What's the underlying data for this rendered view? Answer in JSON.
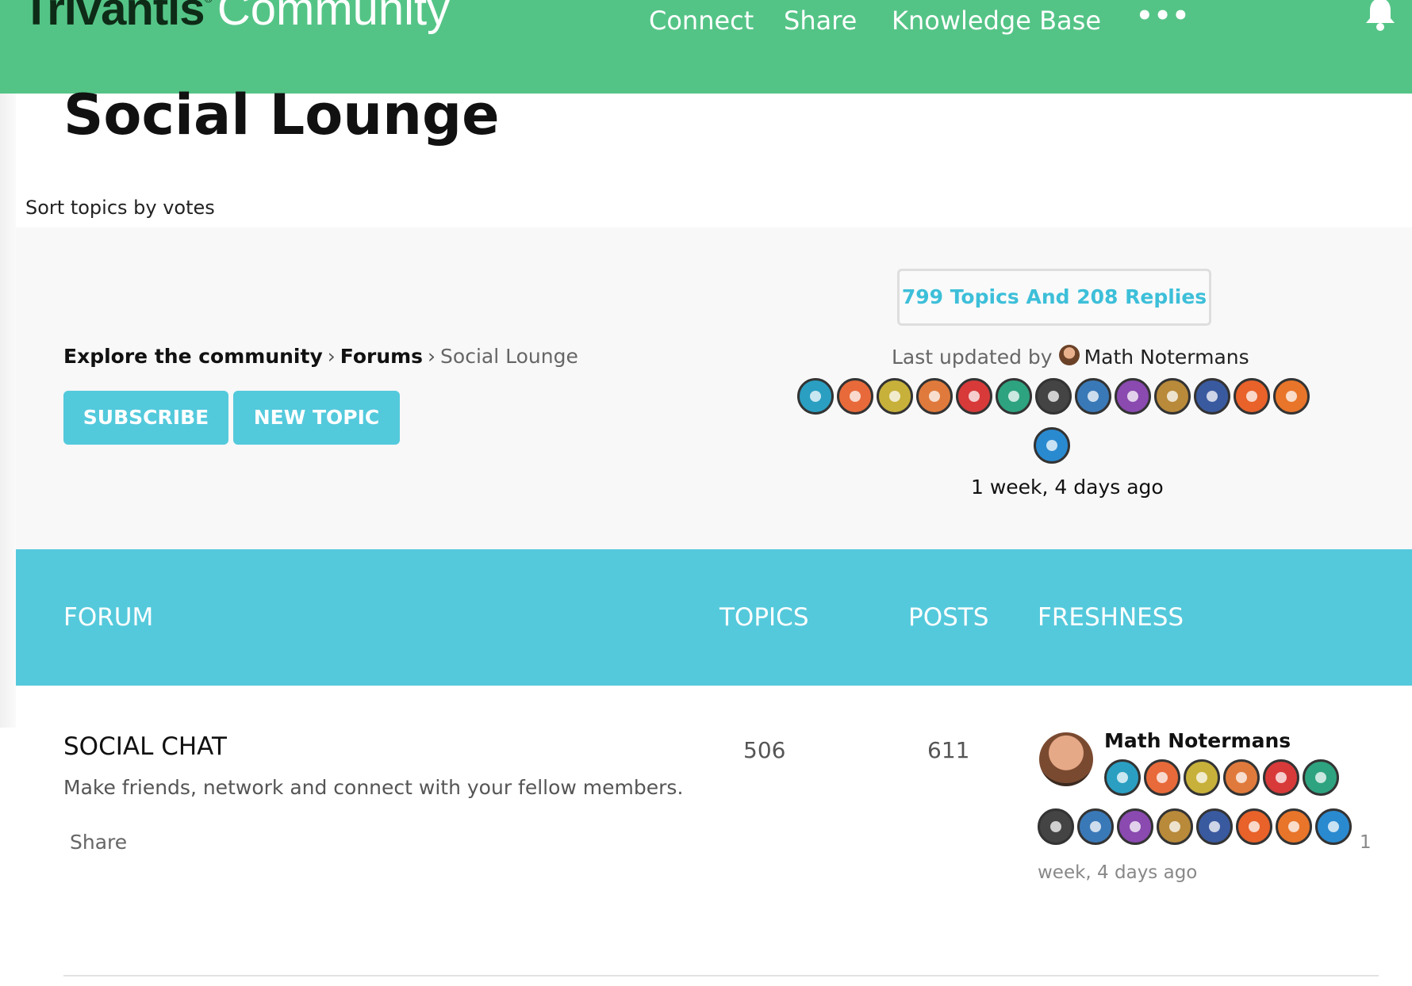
{
  "header": {
    "logo_brand": "Trivantis",
    "logo_tm": "®",
    "logo_word": "Community",
    "nav": [
      "Connect",
      "Share",
      "Knowledge Base"
    ],
    "more": "•••",
    "icon": "bell-icon",
    "bg_color": "#54c486"
  },
  "page": {
    "title": "Social Lounge",
    "sort_link": "Sort topics by votes"
  },
  "breadcrumb": {
    "root": "Explore the community",
    "sep": "›",
    "forums": "Forums",
    "current": "Social Lounge"
  },
  "actions": {
    "subscribe": "SUBSCRIBE",
    "new_topic": "NEW TOPIC",
    "button_color": "#53c9dc"
  },
  "stats": {
    "summary": "799 Topics And 208 Replies",
    "last_updated_label": "Last updated by",
    "last_updated_user": "Math Notermans",
    "time_ago": "1 week, 4 days ago"
  },
  "badges": [
    "#2a9fc2",
    "#e86a3a",
    "#c8b13a",
    "#e07a3c",
    "#d83a3a",
    "#2ea37f",
    "#444444",
    "#3a79b8",
    "#8a4ab0",
    "#b88a3a",
    "#3a5aa0",
    "#e8622a",
    "#e8752a",
    "#2a8ad0"
  ],
  "table": {
    "headers": {
      "forum": "FORUM",
      "topics": "TOPICS",
      "posts": "POSTS",
      "freshness": "FRESHNESS"
    },
    "header_color": "#55c9dc"
  },
  "forum": {
    "title": "SOCIAL CHAT",
    "description": "Make friends, network and connect with your fellow members.",
    "share": "Share",
    "topics": "506",
    "posts": "611",
    "fresh_user": "Math Notermans",
    "fresh_time_1": "1",
    "fresh_time_2": "week, 4 days ago"
  }
}
